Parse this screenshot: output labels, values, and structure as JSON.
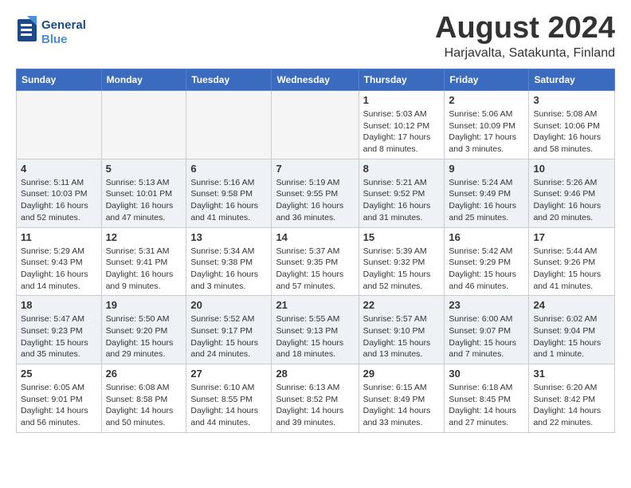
{
  "header": {
    "logo_line1": "General",
    "logo_line2": "Blue",
    "month": "August 2024",
    "location": "Harjavalta, Satakunta, Finland"
  },
  "weekdays": [
    "Sunday",
    "Monday",
    "Tuesday",
    "Wednesday",
    "Thursday",
    "Friday",
    "Saturday"
  ],
  "weeks": [
    [
      {
        "day": "",
        "info": ""
      },
      {
        "day": "",
        "info": ""
      },
      {
        "day": "",
        "info": ""
      },
      {
        "day": "",
        "info": ""
      },
      {
        "day": "1",
        "info": "Sunrise: 5:03 AM\nSunset: 10:12 PM\nDaylight: 17 hours\nand 8 minutes."
      },
      {
        "day": "2",
        "info": "Sunrise: 5:06 AM\nSunset: 10:09 PM\nDaylight: 17 hours\nand 3 minutes."
      },
      {
        "day": "3",
        "info": "Sunrise: 5:08 AM\nSunset: 10:06 PM\nDaylight: 16 hours\nand 58 minutes."
      }
    ],
    [
      {
        "day": "4",
        "info": "Sunrise: 5:11 AM\nSunset: 10:03 PM\nDaylight: 16 hours\nand 52 minutes."
      },
      {
        "day": "5",
        "info": "Sunrise: 5:13 AM\nSunset: 10:01 PM\nDaylight: 16 hours\nand 47 minutes."
      },
      {
        "day": "6",
        "info": "Sunrise: 5:16 AM\nSunset: 9:58 PM\nDaylight: 16 hours\nand 41 minutes."
      },
      {
        "day": "7",
        "info": "Sunrise: 5:19 AM\nSunset: 9:55 PM\nDaylight: 16 hours\nand 36 minutes."
      },
      {
        "day": "8",
        "info": "Sunrise: 5:21 AM\nSunset: 9:52 PM\nDaylight: 16 hours\nand 31 minutes."
      },
      {
        "day": "9",
        "info": "Sunrise: 5:24 AM\nSunset: 9:49 PM\nDaylight: 16 hours\nand 25 minutes."
      },
      {
        "day": "10",
        "info": "Sunrise: 5:26 AM\nSunset: 9:46 PM\nDaylight: 16 hours\nand 20 minutes."
      }
    ],
    [
      {
        "day": "11",
        "info": "Sunrise: 5:29 AM\nSunset: 9:43 PM\nDaylight: 16 hours\nand 14 minutes."
      },
      {
        "day": "12",
        "info": "Sunrise: 5:31 AM\nSunset: 9:41 PM\nDaylight: 16 hours\nand 9 minutes."
      },
      {
        "day": "13",
        "info": "Sunrise: 5:34 AM\nSunset: 9:38 PM\nDaylight: 16 hours\nand 3 minutes."
      },
      {
        "day": "14",
        "info": "Sunrise: 5:37 AM\nSunset: 9:35 PM\nDaylight: 15 hours\nand 57 minutes."
      },
      {
        "day": "15",
        "info": "Sunrise: 5:39 AM\nSunset: 9:32 PM\nDaylight: 15 hours\nand 52 minutes."
      },
      {
        "day": "16",
        "info": "Sunrise: 5:42 AM\nSunset: 9:29 PM\nDaylight: 15 hours\nand 46 minutes."
      },
      {
        "day": "17",
        "info": "Sunrise: 5:44 AM\nSunset: 9:26 PM\nDaylight: 15 hours\nand 41 minutes."
      }
    ],
    [
      {
        "day": "18",
        "info": "Sunrise: 5:47 AM\nSunset: 9:23 PM\nDaylight: 15 hours\nand 35 minutes."
      },
      {
        "day": "19",
        "info": "Sunrise: 5:50 AM\nSunset: 9:20 PM\nDaylight: 15 hours\nand 29 minutes."
      },
      {
        "day": "20",
        "info": "Sunrise: 5:52 AM\nSunset: 9:17 PM\nDaylight: 15 hours\nand 24 minutes."
      },
      {
        "day": "21",
        "info": "Sunrise: 5:55 AM\nSunset: 9:13 PM\nDaylight: 15 hours\nand 18 minutes."
      },
      {
        "day": "22",
        "info": "Sunrise: 5:57 AM\nSunset: 9:10 PM\nDaylight: 15 hours\nand 13 minutes."
      },
      {
        "day": "23",
        "info": "Sunrise: 6:00 AM\nSunset: 9:07 PM\nDaylight: 15 hours\nand 7 minutes."
      },
      {
        "day": "24",
        "info": "Sunrise: 6:02 AM\nSunset: 9:04 PM\nDaylight: 15 hours\nand 1 minute."
      }
    ],
    [
      {
        "day": "25",
        "info": "Sunrise: 6:05 AM\nSunset: 9:01 PM\nDaylight: 14 hours\nand 56 minutes."
      },
      {
        "day": "26",
        "info": "Sunrise: 6:08 AM\nSunset: 8:58 PM\nDaylight: 14 hours\nand 50 minutes."
      },
      {
        "day": "27",
        "info": "Sunrise: 6:10 AM\nSunset: 8:55 PM\nDaylight: 14 hours\nand 44 minutes."
      },
      {
        "day": "28",
        "info": "Sunrise: 6:13 AM\nSunset: 8:52 PM\nDaylight: 14 hours\nand 39 minutes."
      },
      {
        "day": "29",
        "info": "Sunrise: 6:15 AM\nSunset: 8:49 PM\nDaylight: 14 hours\nand 33 minutes."
      },
      {
        "day": "30",
        "info": "Sunrise: 6:18 AM\nSunset: 8:45 PM\nDaylight: 14 hours\nand 27 minutes."
      },
      {
        "day": "31",
        "info": "Sunrise: 6:20 AM\nSunset: 8:42 PM\nDaylight: 14 hours\nand 22 minutes."
      }
    ]
  ]
}
